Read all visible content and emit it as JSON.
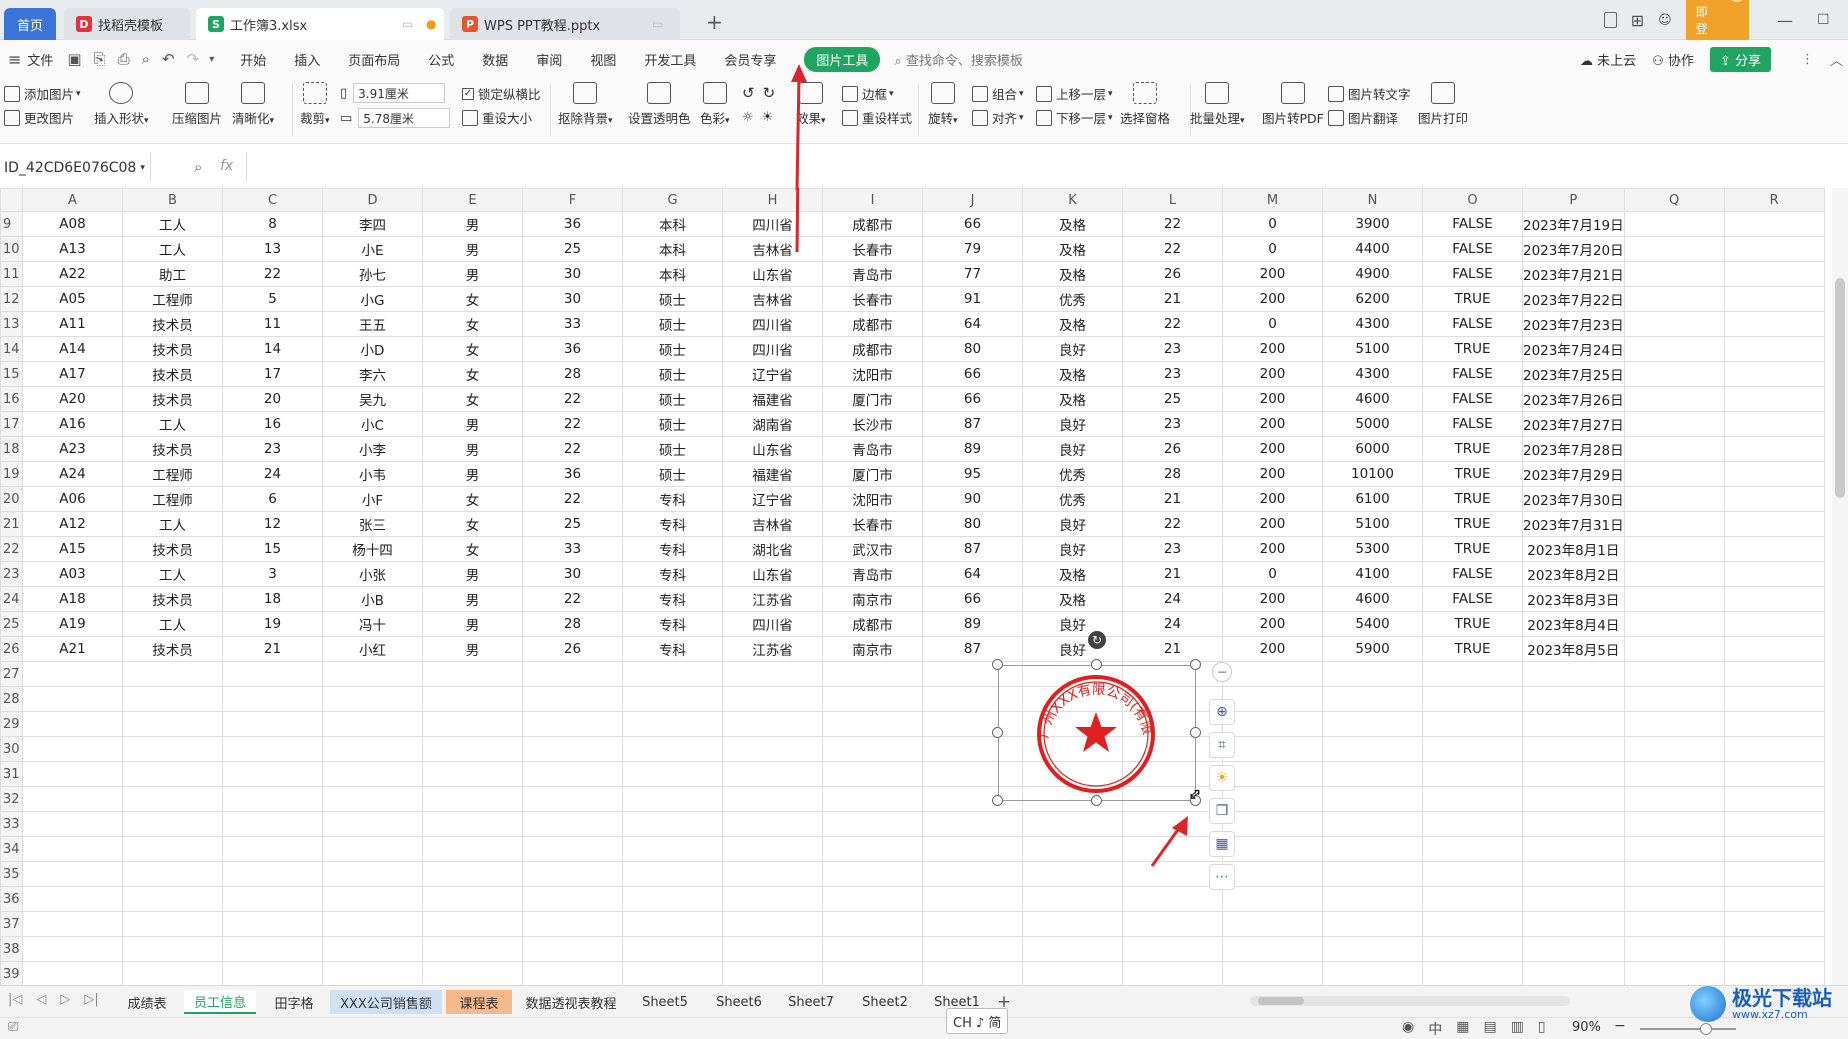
{
  "titlebar": {
    "home": "首页",
    "tabs": [
      {
        "label": "找稻壳模板"
      },
      {
        "label": "工作簿3.xlsx"
      },
      {
        "label": "WPS PPT教程.pptx"
      }
    ],
    "new_tab": "+",
    "login_btn": "立即登录"
  },
  "menubar": {
    "file": "文件",
    "items": [
      "开始",
      "插入",
      "页面布局",
      "公式",
      "数据",
      "审阅",
      "视图",
      "开发工具",
      "会员专享"
    ],
    "picture_tools": "图片工具",
    "search_placeholder": "查找命令、搜索模板",
    "cloud": "未上云",
    "collab": "协作",
    "share": "分享"
  },
  "ribbon": {
    "add_picture": "添加图片",
    "change_picture": "更改图片",
    "insert_shape": "插入形状",
    "compress": "压缩图片",
    "clarity": "清晰化",
    "crop": "裁剪",
    "width": "3.91厘米",
    "height": "5.78厘米",
    "lock_ratio": "锁定纵横比",
    "reset_size": "重设大小",
    "remove_bg": "抠除背景",
    "transparent": "设置透明色",
    "color": "色彩",
    "effects": "效果",
    "border": "边框",
    "reset_style": "重设样式",
    "rotate": "旋转",
    "group": "组合",
    "align": "对齐",
    "bring_forward": "上移一层",
    "send_backward": "下移一层",
    "selection_pane": "选择窗格",
    "batch": "批量处理",
    "to_pdf": "图片转PDF",
    "to_text": "图片转文字",
    "translate": "图片翻译",
    "print": "图片打印"
  },
  "formula": {
    "namebox": "ID_42CD6E076C08",
    "fx": "fx"
  },
  "columns": [
    "A",
    "B",
    "C",
    "D",
    "E",
    "F",
    "G",
    "H",
    "I",
    "J",
    "K",
    "L",
    "M",
    "N",
    "O",
    "P",
    "Q",
    "R"
  ],
  "rows": [
    {
      "n": "9",
      "c": [
        "A08",
        "工人",
        "8",
        "李四",
        "男",
        "36",
        "本科",
        "四川省",
        "成都市",
        "66",
        "及格",
        "22",
        "0",
        "3900",
        "FALSE",
        "2023年7月19日"
      ]
    },
    {
      "n": "10",
      "c": [
        "A13",
        "工人",
        "13",
        "小E",
        "男",
        "25",
        "本科",
        "吉林省",
        "长春市",
        "79",
        "及格",
        "22",
        "0",
        "4400",
        "FALSE",
        "2023年7月20日"
      ]
    },
    {
      "n": "11",
      "c": [
        "A22",
        "助工",
        "22",
        "孙七",
        "男",
        "30",
        "本科",
        "山东省",
        "青岛市",
        "77",
        "及格",
        "26",
        "200",
        "4900",
        "FALSE",
        "2023年7月21日"
      ]
    },
    {
      "n": "12",
      "c": [
        "A05",
        "工程师",
        "5",
        "小G",
        "女",
        "30",
        "硕士",
        "吉林省",
        "长春市",
        "91",
        "优秀",
        "21",
        "200",
        "6200",
        "TRUE",
        "2023年7月22日"
      ]
    },
    {
      "n": "13",
      "c": [
        "A11",
        "技术员",
        "11",
        "王五",
        "女",
        "33",
        "硕士",
        "四川省",
        "成都市",
        "64",
        "及格",
        "22",
        "0",
        "4300",
        "FALSE",
        "2023年7月23日"
      ]
    },
    {
      "n": "14",
      "c": [
        "A14",
        "技术员",
        "14",
        "小D",
        "女",
        "36",
        "硕士",
        "四川省",
        "成都市",
        "80",
        "良好",
        "23",
        "200",
        "5100",
        "TRUE",
        "2023年7月24日"
      ]
    },
    {
      "n": "15",
      "c": [
        "A17",
        "技术员",
        "17",
        "李六",
        "女",
        "28",
        "硕士",
        "辽宁省",
        "沈阳市",
        "66",
        "及格",
        "23",
        "200",
        "4300",
        "FALSE",
        "2023年7月25日"
      ]
    },
    {
      "n": "16",
      "c": [
        "A20",
        "技术员",
        "20",
        "吴九",
        "女",
        "22",
        "硕士",
        "福建省",
        "厦门市",
        "66",
        "及格",
        "25",
        "200",
        "4600",
        "FALSE",
        "2023年7月26日"
      ]
    },
    {
      "n": "17",
      "c": [
        "A16",
        "工人",
        "16",
        "小C",
        "男",
        "22",
        "硕士",
        "湖南省",
        "长沙市",
        "87",
        "良好",
        "23",
        "200",
        "5000",
        "FALSE",
        "2023年7月27日"
      ]
    },
    {
      "n": "18",
      "c": [
        "A23",
        "技术员",
        "23",
        "小李",
        "男",
        "22",
        "硕士",
        "山东省",
        "青岛市",
        "89",
        "良好",
        "26",
        "200",
        "6000",
        "TRUE",
        "2023年7月28日"
      ]
    },
    {
      "n": "19",
      "c": [
        "A24",
        "工程师",
        "24",
        "小韦",
        "男",
        "36",
        "硕士",
        "福建省",
        "厦门市",
        "95",
        "优秀",
        "28",
        "200",
        "10100",
        "TRUE",
        "2023年7月29日"
      ]
    },
    {
      "n": "20",
      "c": [
        "A06",
        "工程师",
        "6",
        "小F",
        "女",
        "22",
        "专科",
        "辽宁省",
        "沈阳市",
        "90",
        "优秀",
        "21",
        "200",
        "6100",
        "TRUE",
        "2023年7月30日"
      ]
    },
    {
      "n": "21",
      "c": [
        "A12",
        "工人",
        "12",
        "张三",
        "女",
        "25",
        "专科",
        "吉林省",
        "长春市",
        "80",
        "良好",
        "22",
        "200",
        "5100",
        "TRUE",
        "2023年7月31日"
      ]
    },
    {
      "n": "22",
      "c": [
        "A15",
        "技术员",
        "15",
        "杨十四",
        "女",
        "33",
        "专科",
        "湖北省",
        "武汉市",
        "87",
        "良好",
        "23",
        "200",
        "5300",
        "TRUE",
        "2023年8月1日"
      ]
    },
    {
      "n": "23",
      "c": [
        "A03",
        "工人",
        "3",
        "小张",
        "男",
        "30",
        "专科",
        "山东省",
        "青岛市",
        "64",
        "及格",
        "21",
        "0",
        "4100",
        "FALSE",
        "2023年8月2日"
      ]
    },
    {
      "n": "24",
      "c": [
        "A18",
        "技术员",
        "18",
        "小B",
        "男",
        "22",
        "专科",
        "江苏省",
        "南京市",
        "66",
        "及格",
        "24",
        "200",
        "4600",
        "FALSE",
        "2023年8月3日"
      ]
    },
    {
      "n": "25",
      "c": [
        "A19",
        "工人",
        "19",
        "冯十",
        "男",
        "28",
        "专科",
        "四川省",
        "成都市",
        "89",
        "良好",
        "24",
        "200",
        "5400",
        "TRUE",
        "2023年8月4日"
      ]
    },
    {
      "n": "26",
      "c": [
        "A21",
        "技术员",
        "21",
        "小红",
        "男",
        "26",
        "专科",
        "江苏省",
        "南京市",
        "87",
        "良好",
        "21",
        "200",
        "5900",
        "TRUE",
        "2023年8月5日"
      ]
    },
    {
      "n": "27",
      "c": []
    },
    {
      "n": "28",
      "c": []
    },
    {
      "n": "29",
      "c": []
    },
    {
      "n": "30",
      "c": []
    },
    {
      "n": "31",
      "c": []
    },
    {
      "n": "32",
      "c": []
    },
    {
      "n": "33",
      "c": []
    },
    {
      "n": "34",
      "c": []
    },
    {
      "n": "35",
      "c": []
    },
    {
      "n": "36",
      "c": []
    },
    {
      "n": "37",
      "c": []
    },
    {
      "n": "38",
      "c": []
    },
    {
      "n": "39",
      "c": []
    }
  ],
  "stamp": {
    "text": "广州XXX有限公司(有限合伙)",
    "color": "#e02020"
  },
  "sheets": [
    "成绩表",
    "员工信息",
    "田字格",
    "XXX公司销售额",
    "课程表",
    "数据透视表教程",
    "Sheet5",
    "Sheet6",
    "Sheet7",
    "Sheet2",
    "Sheet1"
  ],
  "active_sheet": "员工信息",
  "status": {
    "ime": "CH ♪ 简",
    "zoom": "90%",
    "watermark": "极光下载站",
    "watermark_url": "www.xz7.com"
  },
  "colors": {
    "accent_green": "#1fa561",
    "home_blue": "#3b74d9",
    "login_orange": "#f0a12a",
    "arrow_red": "#d9262c"
  }
}
